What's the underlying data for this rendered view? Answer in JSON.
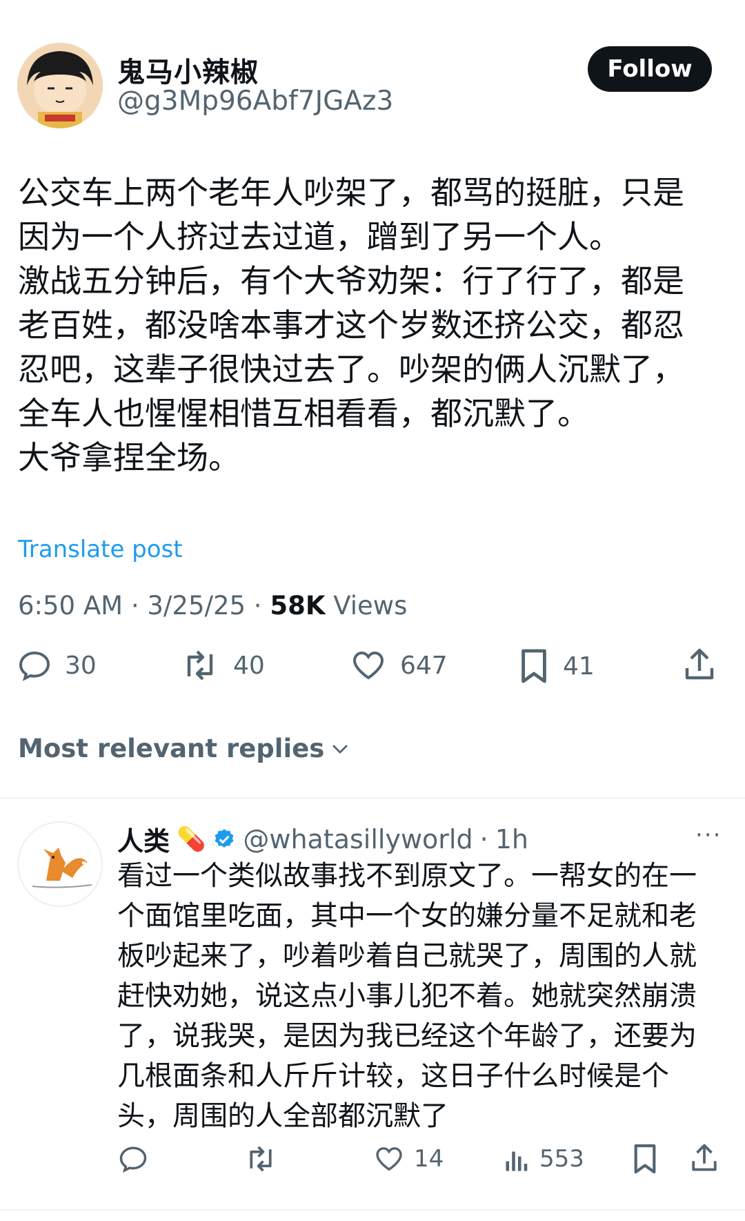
{
  "post": {
    "author_name": "鬼马小辣椒",
    "author_handle": "@g3Mp96Abf7JGAz3",
    "follow_label": "Follow",
    "text": "公交车上两个老年人吵架了，都骂的挺脏，只是\n因为一个人挤过去过道，蹭到了另一个人。\n激战五分钟后，有个大爷劝架：行了行了，都是\n老百姓，都没啥本事才这个岁数还挤公交，都忍\n忍吧，这辈子很快过去了。吵架的俩人沉默了，\n全车人也惺惺相惜互相看看，都沉默了。\n大爷拿捏全场。",
    "translate_label": "Translate post",
    "time": "6:50 AM",
    "date": "3/25/25",
    "views_count": "58K",
    "views_label": "Views",
    "replies": "30",
    "reposts": "40",
    "likes": "647",
    "bookmarks": "41"
  },
  "replies_header": {
    "label": "Most relevant replies"
  },
  "reply": {
    "author_name": "人类",
    "author_emoji": "💊",
    "author_handle": "@whatasillyworld",
    "time": "1h",
    "separator": "·",
    "more": "···",
    "text": "看过一个类似故事找不到原文了。一帮女的在一\n个面馆里吃面，其中一个女的嫌分量不足就和老\n板吵起来了，吵着吵着自己就哭了，周围的人就\n赶快劝她，说这点小事儿犯不着。她就突然崩溃\n了，说我哭，是因为我已经这个年龄了，还要为\n几根面条和人斤斤计较，这日子什么时候是个\n头，周围的人全部都沉默了",
    "likes": "14",
    "views": "553"
  },
  "colors": {
    "accent": "#1d9bf0",
    "text": "#0f1419",
    "muted": "#536471"
  }
}
